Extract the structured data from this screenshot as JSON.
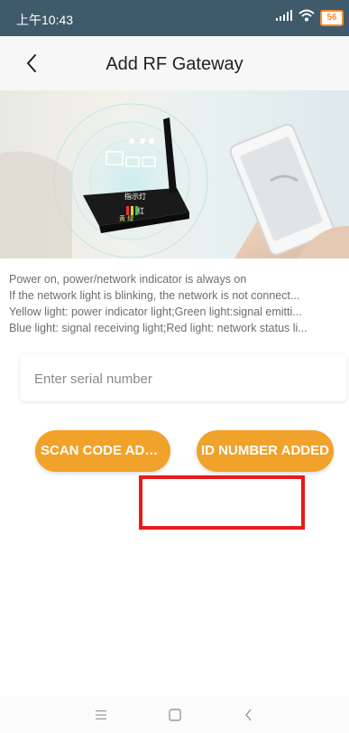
{
  "status_bar": {
    "time": "上午10:43",
    "battery": "56"
  },
  "header": {
    "title": "Add RF Gateway"
  },
  "hero": {
    "router_label_1": "指示灯",
    "router_label_2": "红",
    "router_label_3": "黄 绿",
    "icon": "rf-gateway-router-illustration"
  },
  "description": {
    "lines": [
      "Power on, power/network indicator is always on",
      "If the network light is blinking, the network is not connect...",
      "Yellow light: power indicator light;Green light:signal emitti...",
      "Blue light: signal receiving light;Red light: network status li..."
    ]
  },
  "serial": {
    "placeholder": "Enter serial number",
    "value": ""
  },
  "buttons": {
    "scan": "SCAN CODE ADD...",
    "id": "ID NUMBER ADDED"
  },
  "colors": {
    "accent": "#f0a22a",
    "status_bar": "#3f5a6b",
    "highlight": "#e81a1a"
  },
  "icons": [
    "back-arrow-icon",
    "signal-icon",
    "wifi-icon",
    "battery-icon",
    "menu-icon",
    "home-icon",
    "back-nav-icon"
  ]
}
